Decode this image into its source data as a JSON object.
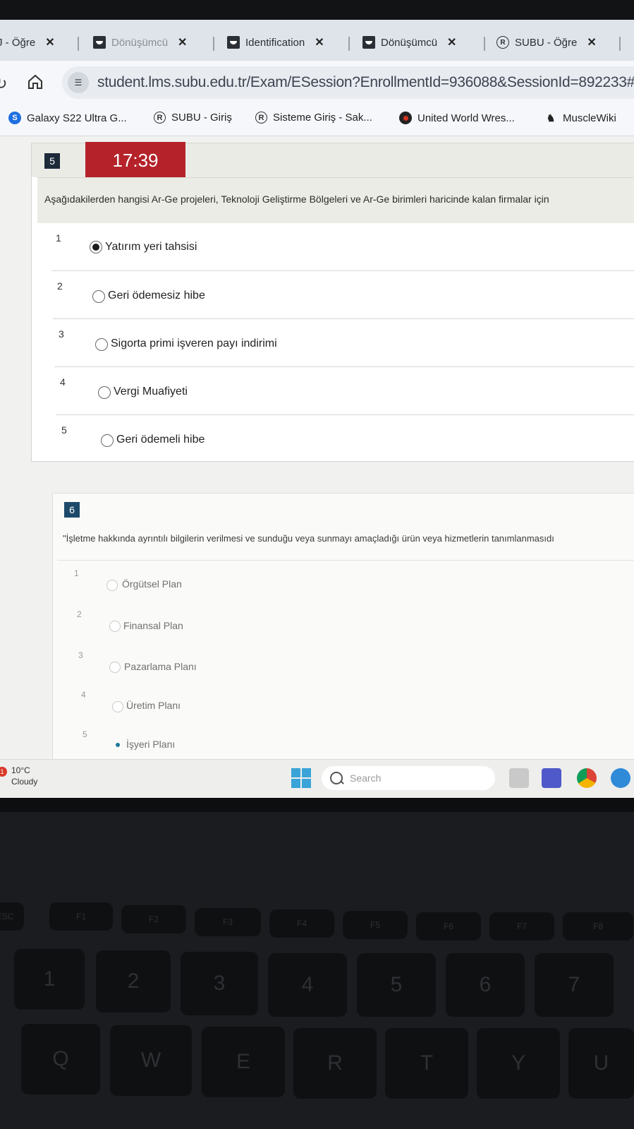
{
  "browser": {
    "tabs": [
      {
        "label": "J - Öğre",
        "favicon": "generic-page",
        "close": "✕"
      },
      {
        "label": "Dönüşümcü",
        "favicon": "converter",
        "close": "✕"
      },
      {
        "label": "Identification",
        "favicon": "converter",
        "close": "✕"
      },
      {
        "label": "Dönüşümcü",
        "favicon": "converter",
        "close": "✕"
      },
      {
        "label": "SUBU - Öğre",
        "favicon": "subu-logo",
        "close": "✕"
      }
    ],
    "url": "student.lms.subu.edu.tr/Exam/ESession?EnrollmentId=936088&SessionId=892233#!",
    "bookmarks": [
      {
        "label": "Galaxy S22 Ultra G...",
        "icon": "samsung-icon"
      },
      {
        "label": "SUBU - Giriş",
        "icon": "subu-icon"
      },
      {
        "label": "Sisteme Giriş - Sak...",
        "icon": "subu-icon"
      },
      {
        "label": "United World Wres...",
        "icon": "uww-icon"
      },
      {
        "label": "MuscleWiki",
        "icon": "musclewiki-icon"
      }
    ]
  },
  "exam": {
    "timer": "17:39",
    "question5": {
      "number": "5",
      "text": "Aşağıdakilerden hangisi Ar-Ge projeleri, Teknoloji Geliştirme Bölgeleri ve Ar-Ge birimleri haricinde kalan firmalar için",
      "options": [
        {
          "num": "1",
          "label": "Yatırım yeri tahsisi",
          "selected": true
        },
        {
          "num": "2",
          "label": "Geri ödemesiz hibe",
          "selected": false
        },
        {
          "num": "3",
          "label": "Sigorta primi işveren payı indirimi",
          "selected": false
        },
        {
          "num": "4",
          "label": "Vergi Muafiyeti",
          "selected": false
        },
        {
          "num": "5",
          "label": "Geri ödemeli hibe",
          "selected": false
        }
      ]
    },
    "question6": {
      "number": "6",
      "text": "\"İşletme hakkında ayrıntılı bilgilerin verilmesi ve sunduğu veya sunmayı amaçladığı ürün veya hizmetlerin tanımlanmasıdı",
      "options": [
        {
          "num": "1",
          "label": "Örgütsel Plan",
          "selected": false
        },
        {
          "num": "2",
          "label": "Finansal Plan",
          "selected": false
        },
        {
          "num": "3",
          "label": "Pazarlama Planı",
          "selected": false
        },
        {
          "num": "4",
          "label": "Üretim Planı",
          "selected": false
        },
        {
          "num": "5",
          "label": "İşyeri Planı",
          "selected": true
        }
      ]
    }
  },
  "taskbar": {
    "weather_temp": "10°C",
    "weather_condition": "Cloudy",
    "weather_badge": "1",
    "search_placeholder": "Search"
  },
  "keyboard": {
    "fn_row": [
      "ESC",
      "F1",
      "F2",
      "F3",
      "F4",
      "F5",
      "F6",
      "F7",
      "F8"
    ],
    "number_row": [
      "1",
      "2",
      "3",
      "4",
      "5",
      "6",
      "7"
    ],
    "letter_row": [
      "Q",
      "W",
      "E",
      "R",
      "T",
      "Y",
      "U"
    ]
  },
  "colors": {
    "timer_bg": "#b5222a",
    "question_badge": "#1d2a3a",
    "tab_bar": "#dfe3ea"
  }
}
